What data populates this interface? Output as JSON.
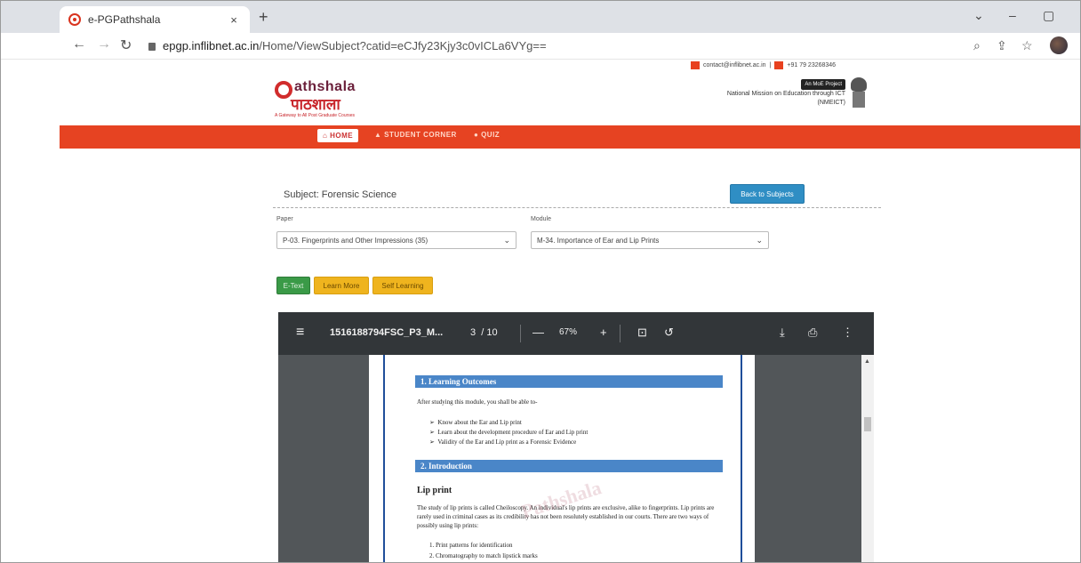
{
  "browser": {
    "tab_title": "e-PGPathshala",
    "tab_close": "×",
    "new_tab": "+",
    "url_host": "epgp.inflibnet.ac.in",
    "url_path": "/Home/ViewSubject?catid=eCJfy23Kjy3c0vICLa6VYg==",
    "win_minimize": "–",
    "win_restore": "▢",
    "win_menu": "⌄"
  },
  "site": {
    "email": "contact@inflibnet.ac.in",
    "phone": "+91 79 23268346",
    "logo_en": "athshala",
    "logo_hi": "पाठशाला",
    "logo_tagline": "A Gateway to All Post Graduate Courses",
    "mhrd_badge": "An MoE Project",
    "mission_line": "National Mission on Education through ICT",
    "mission_abbr": "(NMEICT)"
  },
  "nav": {
    "home": "HOME",
    "student_corner": "STUDENT CORNER",
    "quiz": "QUIZ"
  },
  "content": {
    "subject": "Subject: Forensic Science",
    "back_button": "Back to Subjects",
    "paper_label": "Paper",
    "paper_value": "P-03. Fingerprints and Other Impressions (35)",
    "module_label": "Module",
    "module_value": "M-34. Importance of Ear and Lip Prints",
    "btn_etext": "E-Text",
    "btn_learn_more": "Learn More",
    "btn_self_learning": "Self Learning"
  },
  "pdf": {
    "filename": "1516188794FSC_P3_M...",
    "page_current": "3",
    "page_total": "/ 10",
    "zoom": "67%",
    "h1": "1. Learning Outcomes",
    "intro_text": "After studying this module, you shall be able to-",
    "outcomes": [
      "Know about the Ear and Lip print",
      "Learn about the development procedure of Ear and Lip print",
      "Validity of the Ear and Lip print as a Forensic Evidence"
    ],
    "h2": "2. Introduction",
    "sub_h": "Lip print",
    "para": "The study of lip prints is called Cheiloscopy. An individual's lip prints are exclusive, alike to fingerprints. Lip prints are rarely used in criminal cases as its credibility has not been resolutely established in our courts. There are two ways of possibly using lip prints:",
    "ways": [
      "1.   Print patterns for identification",
      "2.   Chromatography to match lipstick marks"
    ],
    "watermark": "Pathshala"
  }
}
